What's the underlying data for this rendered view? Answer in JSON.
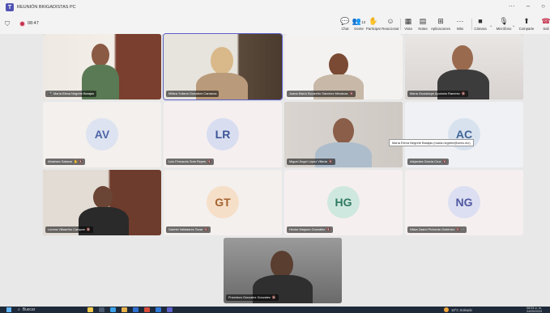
{
  "window": {
    "title": "REUNIÓN BRIGADISTAS PC",
    "controls": [
      "···",
      "–",
      "○"
    ]
  },
  "toolbar": {
    "timer": "08:47",
    "buttons": [
      {
        "name": "chat",
        "label": "Chat",
        "icon": "💬"
      },
      {
        "name": "people",
        "label": "Gente",
        "icon": "👥",
        "badge": "13"
      },
      {
        "name": "raise-hand",
        "label": "Participar",
        "icon": "✋"
      },
      {
        "name": "react",
        "label": "Reaccionar",
        "icon": "☺"
      },
      {
        "name": "view",
        "label": "Vista",
        "icon": "▦"
      },
      {
        "name": "notes",
        "label": "Notas",
        "icon": "▤"
      },
      {
        "name": "apps",
        "label": "Aplicaciones",
        "icon": "⊞"
      },
      {
        "name": "more",
        "label": "Más",
        "icon": "···"
      },
      {
        "name": "camera",
        "label": "Cámara",
        "icon": "■"
      },
      {
        "name": "mic",
        "label": "Micrófono",
        "icon": "🎙"
      },
      {
        "name": "share",
        "label": "Comparte",
        "icon": "⬆"
      }
    ],
    "leave_label": "Sali",
    "people_count": "13"
  },
  "participants": [
    {
      "name": "María Elena Negrete Barajas",
      "type": "video",
      "mic": "🎤",
      "active": false
    },
    {
      "name": "Militza Yuliana González Carranza",
      "type": "video",
      "mic": "",
      "active": true
    },
    {
      "name": "Juana María Escareño Sánchez Mendoza",
      "type": "video",
      "mic": "🔇",
      "active": false
    },
    {
      "name": "María Guadalupe Apolonio Ramírez",
      "type": "video",
      "mic": "🔇",
      "active": false
    },
    {
      "name": "Abraham Salazar",
      "initials": "AV",
      "type": "avatar",
      "mic": "✋ 🔇",
      "color": "#6b7eb8",
      "bg": "#dde3f0"
    },
    {
      "name": "Luis Fernando Soto Reyes",
      "initials": "LR",
      "type": "avatar",
      "mic": "🔇",
      "color": "#5a6fa8",
      "bg": "#d8def0"
    },
    {
      "name": "Miguel Ángel López Villeda",
      "type": "video",
      "mic": "🔇",
      "active": false
    },
    {
      "name": "Alejandra García Cruz",
      "initials": "AC",
      "type": "avatar",
      "mic": "🔇",
      "color": "#5f7fa8",
      "bg": "#d8e2ef"
    },
    {
      "name": "Lorena Villaseñor Campos",
      "type": "video",
      "mic": "🔇",
      "active": false
    },
    {
      "name": "Gabriel Valladares Tovar",
      "initials": "GT",
      "type": "avatar",
      "mic": "🔇",
      "color": "#b0703a",
      "bg": "#f6dfc8"
    },
    {
      "name": "Hector Maqueo González",
      "initials": "HG",
      "type": "avatar",
      "mic": "🔇",
      "color": "#3f8a72",
      "bg": "#cfe8df"
    },
    {
      "name": "Nilsia Zaahd Pichardo Gutiérrez",
      "initials": "NG",
      "type": "avatar",
      "mic": "🔇 ···",
      "color": "#6b72b0",
      "bg": "#dcdff2"
    },
    {
      "name": "Francisco Gonzalez Gonzalez",
      "type": "video",
      "mic": "🔇",
      "active": false
    }
  ],
  "tooltip": "María Elena Negrete Barajas (maria.negrete@seeo.mx)",
  "taskbar": {
    "search": "Buscar",
    "weather": "18°C Soleado",
    "time": "08:54 a. m.",
    "date": "24/09/2023"
  }
}
